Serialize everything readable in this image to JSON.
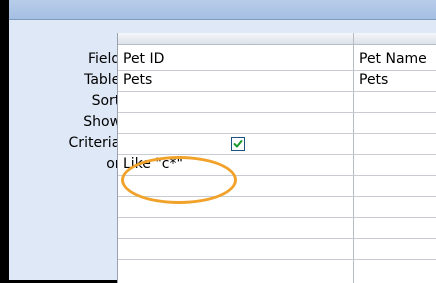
{
  "row_labels": {
    "field": "Field:",
    "table": "Table:",
    "sort": "Sort:",
    "show": "Show:",
    "criteria": "Criteria:",
    "or": "or:"
  },
  "columns": [
    {
      "field": "Pet ID",
      "table": "Pets",
      "sort": "",
      "show": true,
      "criteria": "Like \"c*\"",
      "or": ""
    },
    {
      "field": "Pet Name",
      "table": "Pets",
      "sort": "",
      "show": false,
      "criteria": "",
      "or": ""
    }
  ],
  "colors": {
    "highlight": "#f0a22a",
    "checkmark": "#1e9a2a"
  }
}
